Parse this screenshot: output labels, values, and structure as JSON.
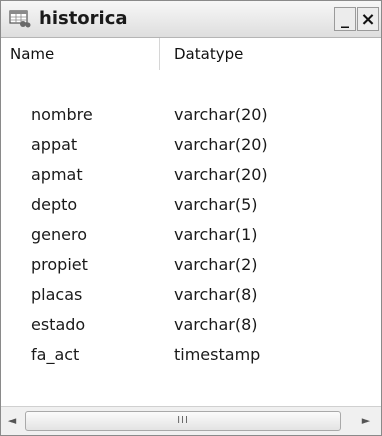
{
  "window": {
    "title": "historica",
    "minimize_label": "_",
    "close_label": "×",
    "icon": "table-icon"
  },
  "columns": {
    "name_header": "Name",
    "type_header": "Datatype"
  },
  "rows": [
    {
      "name": "nombre",
      "type": "varchar(20)"
    },
    {
      "name": "appat",
      "type": "varchar(20)"
    },
    {
      "name": "apmat",
      "type": "varchar(20)"
    },
    {
      "name": "depto",
      "type": "varchar(5)"
    },
    {
      "name": "genero",
      "type": "varchar(1)"
    },
    {
      "name": "propiet",
      "type": "varchar(2)"
    },
    {
      "name": "placas",
      "type": "varchar(8)"
    },
    {
      "name": "estado",
      "type": "varchar(8)"
    },
    {
      "name": "fa_act",
      "type": "timestamp"
    }
  ],
  "scrollbar": {
    "left_arrow": "◄",
    "right_arrow": "►",
    "grip": "III"
  }
}
